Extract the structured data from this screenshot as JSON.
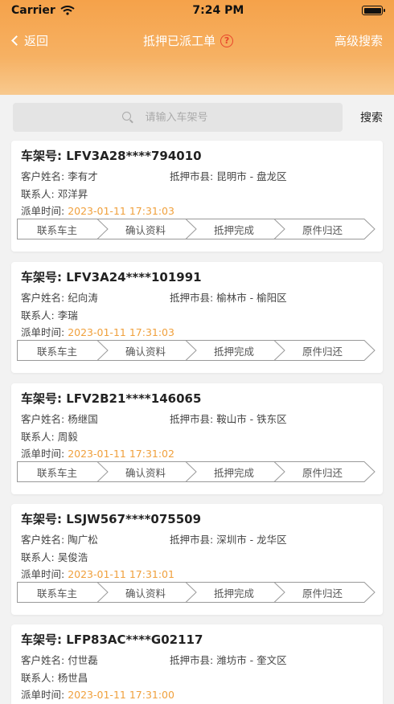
{
  "status_bar": {
    "carrier": "Carrier",
    "time": "7:24 PM"
  },
  "nav": {
    "back_label": "返回",
    "title": "抵押已派工单",
    "help_glyph": "?",
    "advanced_search": "高级搜索"
  },
  "search": {
    "placeholder": "请输入车架号",
    "value": "",
    "button": "搜索"
  },
  "labels": {
    "vin": "车架号:",
    "customer": "客户姓名:",
    "region": "抵押市县:",
    "contact": "联系人:",
    "dispatch_time": "派单时间:"
  },
  "steps": [
    "联系车主",
    "确认资料",
    "抵押完成",
    "原件归还"
  ],
  "orders": [
    {
      "vin": "LFV3A28****794010",
      "customer": "李有才",
      "region": "昆明市 - 盘龙区",
      "contact": "邓洋昇",
      "time": "2023-01-11 17:31:03"
    },
    {
      "vin": "LFV3A24****101991",
      "customer": "纪向涛",
      "region": "榆林市 - 榆阳区",
      "contact": "李瑞",
      "time": "2023-01-11 17:31:03"
    },
    {
      "vin": "LFV2B21****146065",
      "customer": "杨继国",
      "region": "鞍山市 - 铁东区",
      "contact": "周毅",
      "time": "2023-01-11 17:31:02"
    },
    {
      "vin": "LSJW567****075509",
      "customer": "陶广松",
      "region": "深圳市 - 龙华区",
      "contact": "吴俊浩",
      "time": "2023-01-11 17:31:01"
    },
    {
      "vin": "LFP83AC****G02117",
      "customer": "付世磊",
      "region": "潍坊市 - 奎文区",
      "contact": "杨世昌",
      "time": "2023-01-11 17:31:00"
    }
  ]
}
